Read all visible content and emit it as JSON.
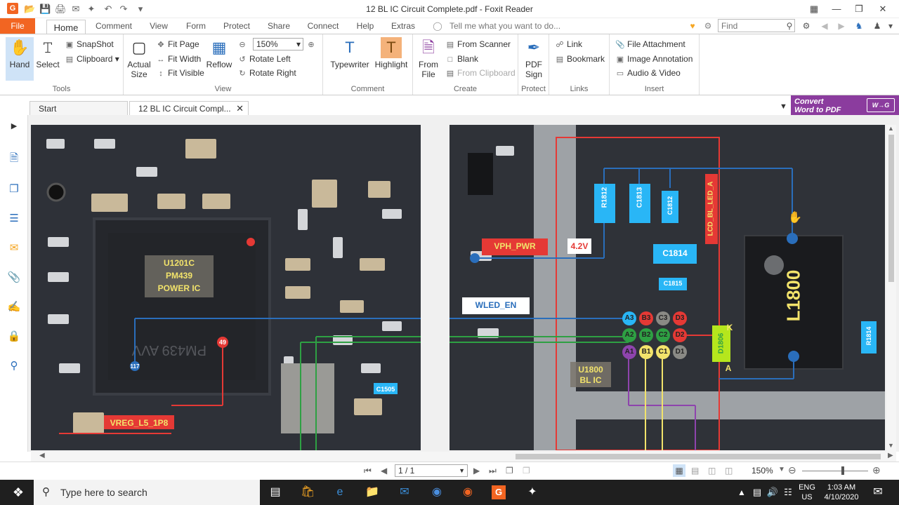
{
  "window": {
    "title": "12 BL IC Circuit  Complete.pdf - Foxit Reader"
  },
  "ribbon_tabs": [
    "File",
    "Home",
    "Comment",
    "View",
    "Form",
    "Protect",
    "Share",
    "Connect",
    "Help",
    "Extras"
  ],
  "tell_me": "Tell me what you want to do...",
  "find_placeholder": "Find",
  "tools": {
    "hand": "Hand",
    "select": "Select",
    "snapshot": "SnapShot",
    "clipboard": "Clipboard",
    "label": "Tools"
  },
  "view": {
    "actual_size": "Actual Size",
    "fit_page": "Fit Page",
    "fit_width": "Fit Width",
    "fit_visible": "Fit Visible",
    "reflow": "Reflow",
    "zoom": "150%",
    "rotate_left": "Rotate Left",
    "rotate_right": "Rotate Right",
    "label": "View"
  },
  "comment": {
    "typewriter": "Typewriter",
    "highlight": "Highlight",
    "label": "Comment"
  },
  "create": {
    "from_file": "From File",
    "from_scanner": "From Scanner",
    "blank": "Blank",
    "from_clipboard": "From Clipboard",
    "label": "Create"
  },
  "protect": {
    "pdf_sign": "PDF Sign",
    "label": "Protect"
  },
  "links": {
    "link": "Link",
    "bookmark": "Bookmark",
    "label": "Links"
  },
  "insert": {
    "file_attachment": "File Attachment",
    "image_annotation": "Image Annotation",
    "audio_video": "Audio & Video",
    "label": "Insert"
  },
  "convert": {
    "line1": "Convert",
    "line2": "Word to PDF"
  },
  "doc_tabs": {
    "start": "Start",
    "current": "12 BL IC Circuit  Compl..."
  },
  "left_page": {
    "ic_label": [
      "U1201C",
      "PM439",
      "POWER IC"
    ],
    "pin_117": "117",
    "pin_49": "49",
    "vreg": "VREG_L5_1P8",
    "c1505": "C1505",
    "chip_mark": "PM439 AVV"
  },
  "right_page": {
    "vph_pwr": "VPH_PWR",
    "v42": "4.2V",
    "wled_en": "WLED_EN",
    "lcd_bl": "LCD_BL_LED_A",
    "r1812": "R1812",
    "c1813": "C1813",
    "c1812": "C1812",
    "c1814": "C1814",
    "c1815": "C1815",
    "l1800": "L1800",
    "d1806": "D1806",
    "k": "K",
    "a": "A",
    "r1814": "R1814",
    "u1800": [
      "U1800",
      "BL IC"
    ],
    "pins_row1": [
      "A3",
      "B3",
      "C3",
      "D3"
    ],
    "pins_row2": [
      "A2",
      "B2",
      "C2",
      "D2"
    ],
    "pins_row3": [
      "A1",
      "B1",
      "C1",
      "D1"
    ]
  },
  "statusbar": {
    "page": "1 / 1",
    "zoom": "150%"
  },
  "taskbar": {
    "search": "Type here to search",
    "lang1": "ENG",
    "lang2": "US",
    "time": "1:03 AM",
    "date": "4/10/2020"
  }
}
